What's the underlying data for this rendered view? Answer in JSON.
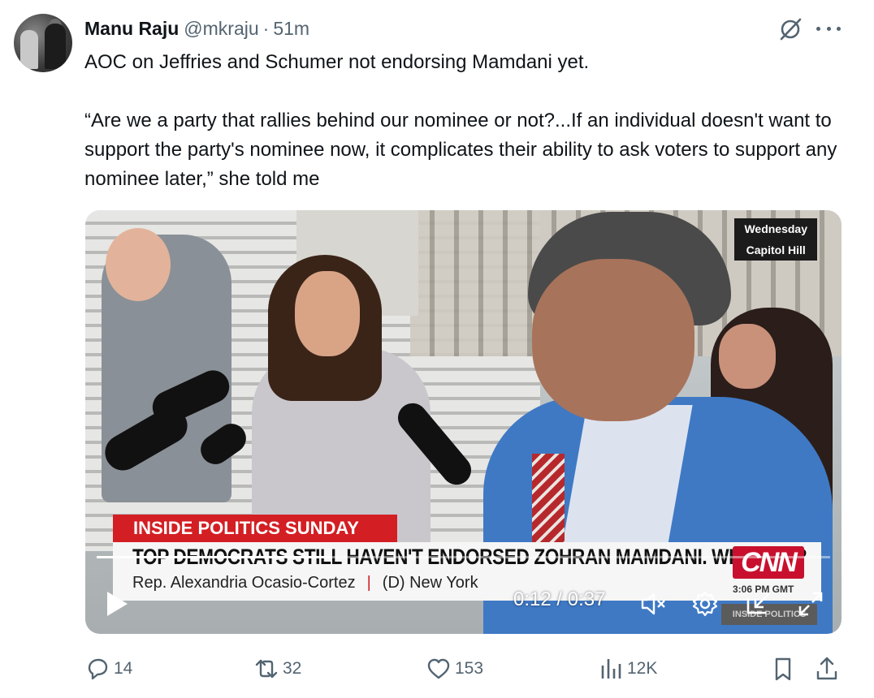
{
  "tweet": {
    "author_name": "Manu Raju",
    "handle": "@mkraju",
    "separator": "·",
    "time": "51m",
    "text_line1": "AOC on Jeffries and Schumer not endorsing Mamdani yet.",
    "text_quote": "“Are we a party that rallies behind our nominee or not?...If an individual doesn't want to support the party's nominee now, it complicates their ability to ask voters to support any nominee later,” she told me"
  },
  "video": {
    "location_day": "Wednesday",
    "location_place": "Capitol Hill",
    "show_banner": "INSIDE POLITICS SUNDAY",
    "headline": "TOP DEMOCRATS STILL HAVEN'T ENDORSED ZOHRAN MAMDANI. WHY NOT?",
    "subject_name": "Rep. Alexandria Ocasio-Cortez",
    "subject_sep": "|",
    "subject_party": "(D) New York",
    "network_logo": "CNN",
    "network_time": "3:06 PM GMT",
    "network_show": "INSIDE POLITICS",
    "current_time": "0:12",
    "time_sep": "/",
    "duration": "0:37",
    "progress_fraction": 0.32
  },
  "actions": {
    "replies": "14",
    "reposts": "32",
    "likes": "153",
    "views": "12K"
  },
  "icons": [
    "avatar",
    "grok-icon",
    "more-icon",
    "play-icon",
    "mute-icon",
    "settings-icon",
    "pip-icon",
    "expand-icon",
    "reply-icon",
    "repost-icon",
    "like-icon",
    "views-icon",
    "bookmark-icon",
    "share-icon"
  ],
  "colors": {
    "text": "#0f1419",
    "secondary": "#536471",
    "cnn_red": "#d31f24"
  }
}
